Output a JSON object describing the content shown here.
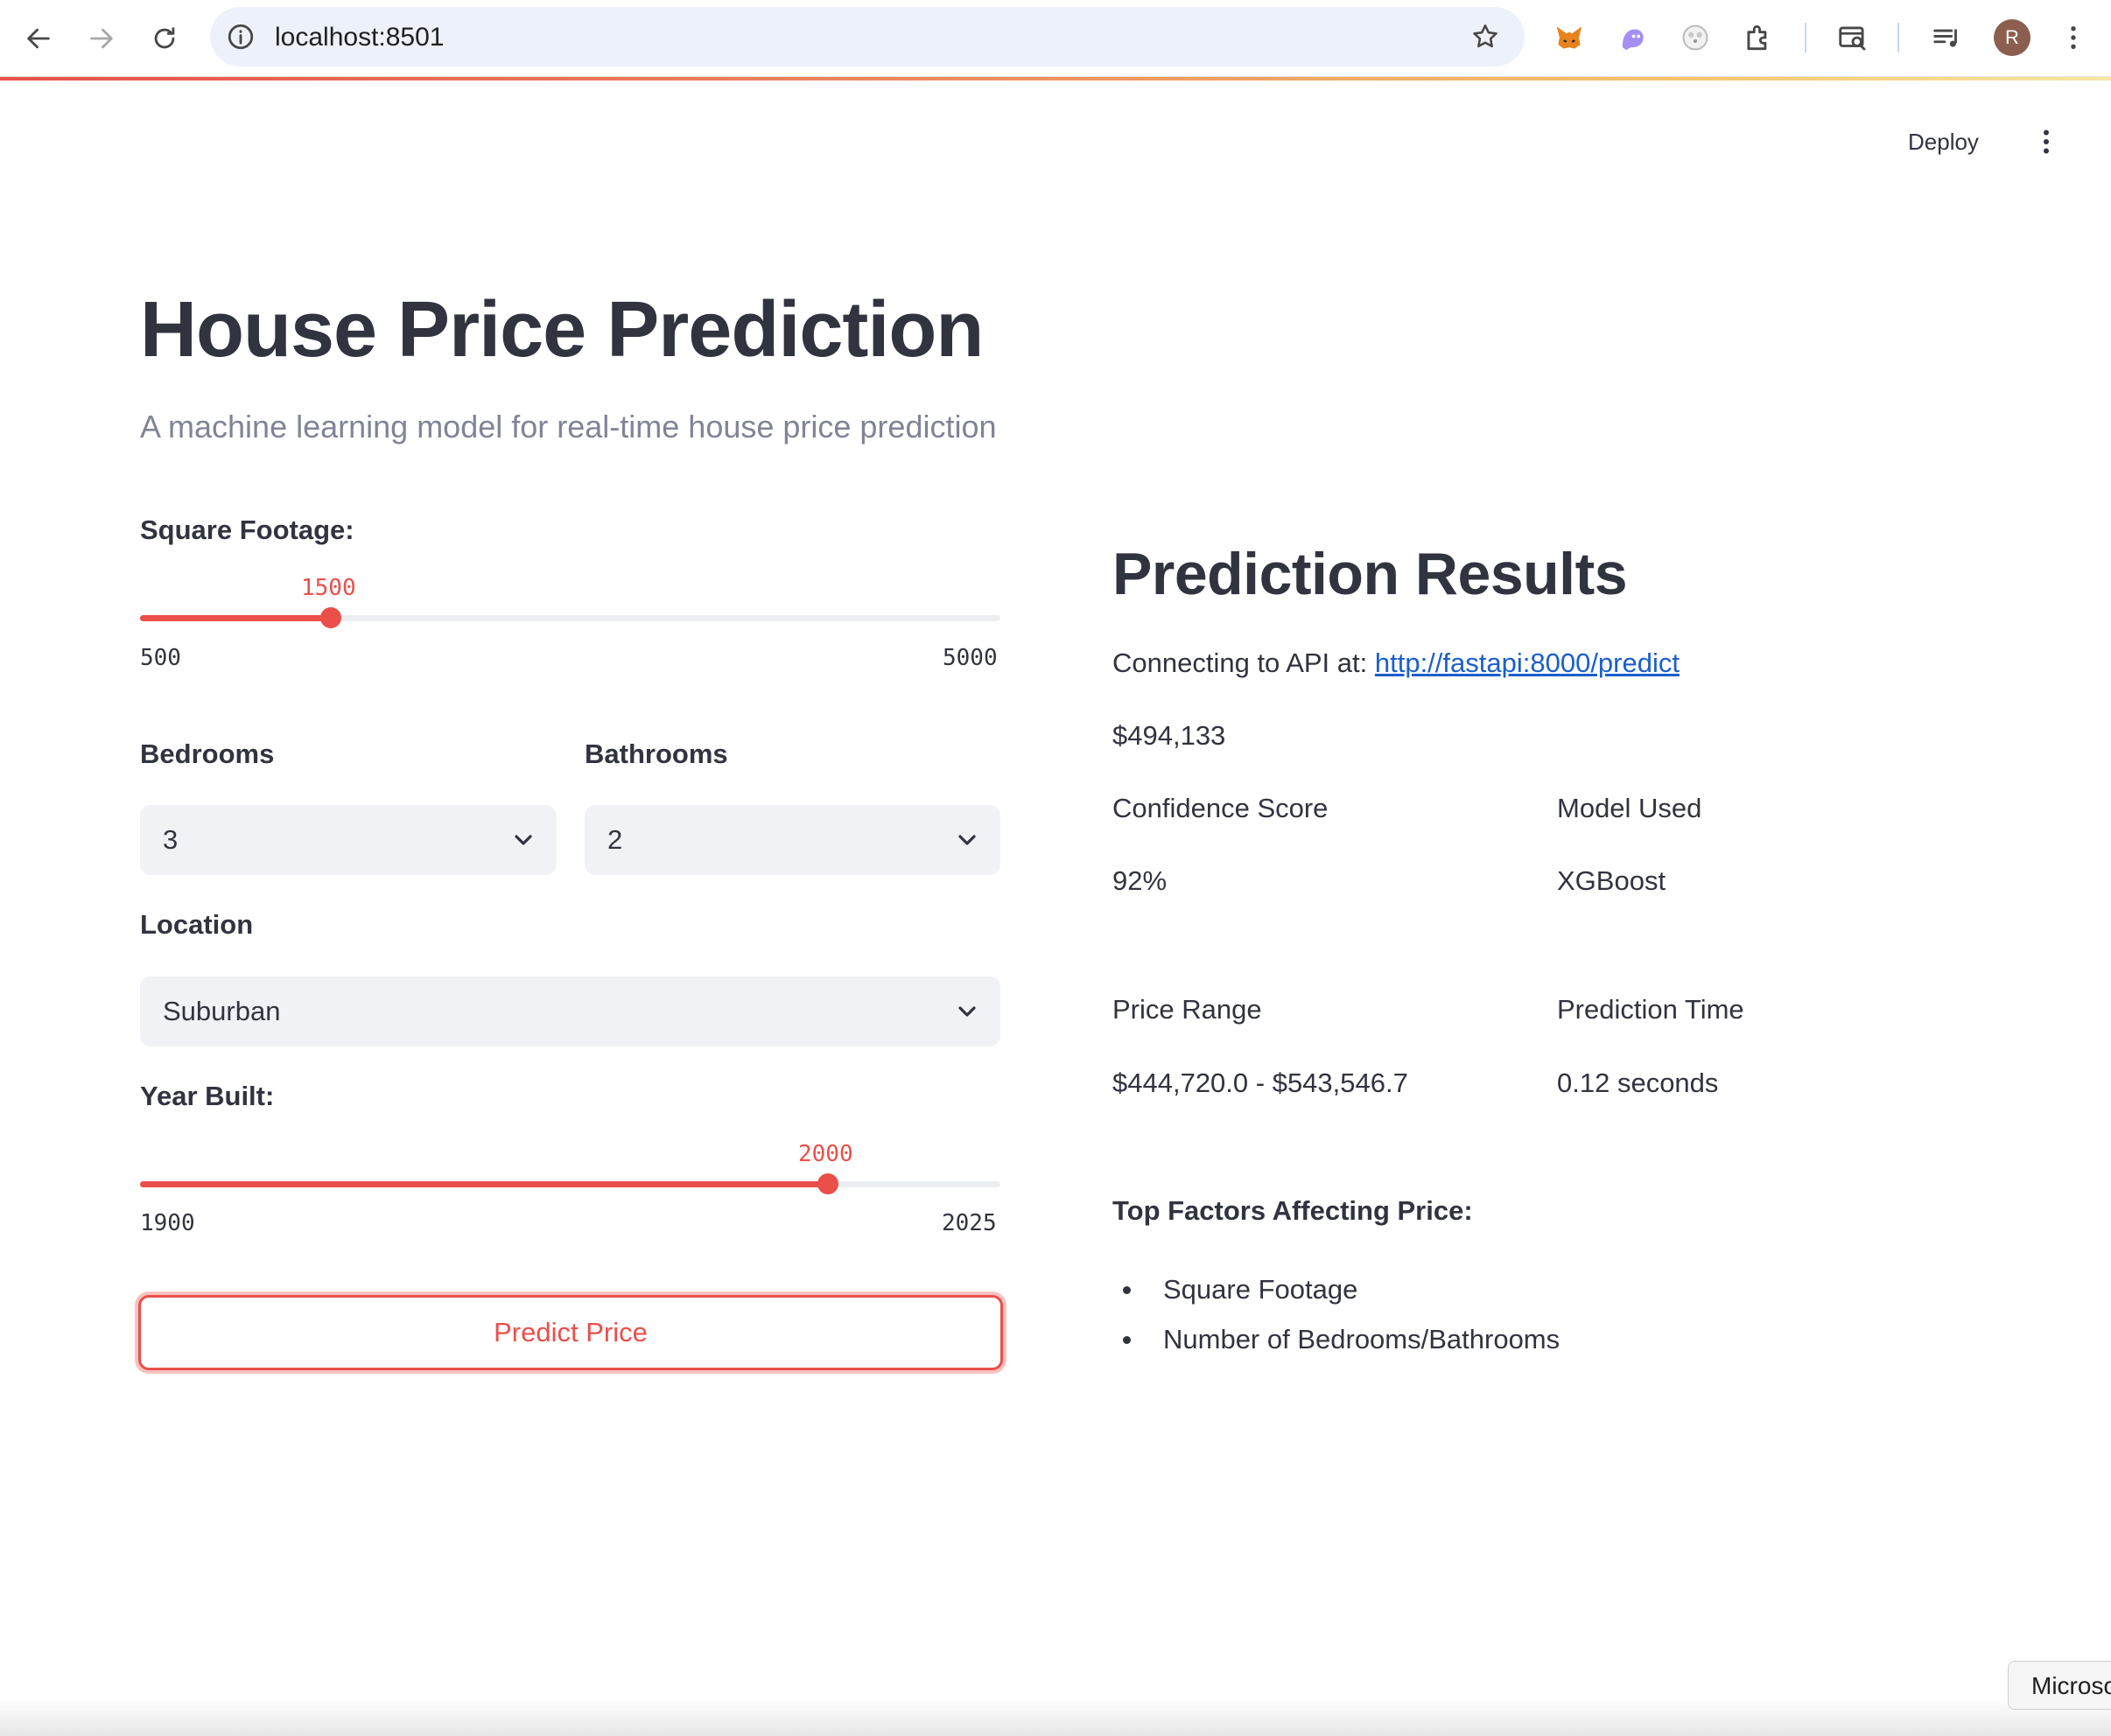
{
  "browser": {
    "url": "localhost:8501",
    "avatar_letter": "R",
    "progress_colors": [
      "#e8504a",
      "#f5c56b"
    ]
  },
  "header": {
    "deploy_label": "Deploy"
  },
  "page": {
    "title": "House Price Prediction",
    "subtitle": "A machine learning model for real-time house price prediction",
    "accent_color": "#ea4f4a"
  },
  "inputs": {
    "square_footage": {
      "label": "Square Footage:",
      "min": "500",
      "max": "5000",
      "value": "1500"
    },
    "bedrooms": {
      "label": "Bedrooms",
      "value": "3"
    },
    "bathrooms": {
      "label": "Bathrooms",
      "value": "2"
    },
    "location": {
      "label": "Location",
      "value": "Suburban"
    },
    "year_built": {
      "label": "Year Built:",
      "min": "1900",
      "max": "2025",
      "value": "2000"
    },
    "predict_button": "Predict Price"
  },
  "results": {
    "title": "Prediction Results",
    "api_prefix": "Connecting to API at: ",
    "api_url": "http://fastapi:8000/predict",
    "price": "$494,133",
    "confidence_label": "Confidence Score",
    "confidence_value": "92%",
    "model_label": "Model Used",
    "model_value": "XGBoost",
    "range_label": "Price Range",
    "range_value": "$444,720.0 - $543,546.7",
    "time_label": "Prediction Time",
    "time_value": "0.12 seconds",
    "factors_title": "Top Factors Affecting Price:",
    "factors": [
      "Square Footage",
      "Number of Bedrooms/Bathrooms"
    ]
  },
  "footer": {
    "chip_text": "Microsoft"
  }
}
